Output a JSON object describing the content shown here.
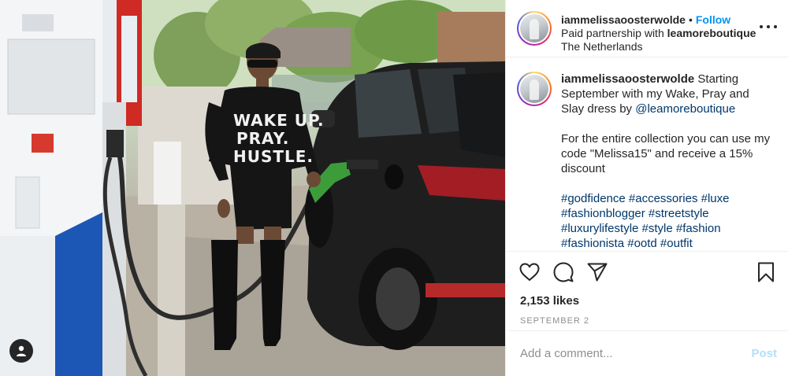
{
  "post": {
    "author": {
      "username": "iammelissaoosterwolde",
      "follow_label": "Follow",
      "separator": "•",
      "paid_prefix": "Paid partnership with ",
      "partner": "leamoreboutique",
      "location": "The Netherlands"
    },
    "photo": {
      "shirt_text": [
        "WAKE UP.",
        "PRAY.",
        "HUSTLE."
      ]
    },
    "caption": {
      "username": "iammelissaoosterwolde",
      "text_before_mention": " Starting September with my Wake, Pray and Slay dress by ",
      "mention": "@leamoreboutique",
      "paragraph2": "For the entire collection you can use my code \"Melissa15\" and receive a 15% discount",
      "hashtags": "#godfidence #accessories #luxe #fashionblogger #streetstyle #luxurylifestyle #style #fashion #fashionista #ootd #outfit"
    },
    "likes": "2,153 likes",
    "date": "SEPTEMBER 2",
    "comment_box": {
      "placeholder": "Add a comment...",
      "post_label": "Post"
    },
    "icons": {
      "more": "more-options-icon",
      "like": "heart-icon",
      "comment": "comment-icon",
      "share": "share-icon",
      "save": "bookmark-icon",
      "tag": "user-tag-icon"
    },
    "colors": {
      "link": "#00376b",
      "follow": "#0095f6",
      "post_disabled": "#b2dffc",
      "muted": "#8e8e8e",
      "text": "#262626"
    }
  }
}
